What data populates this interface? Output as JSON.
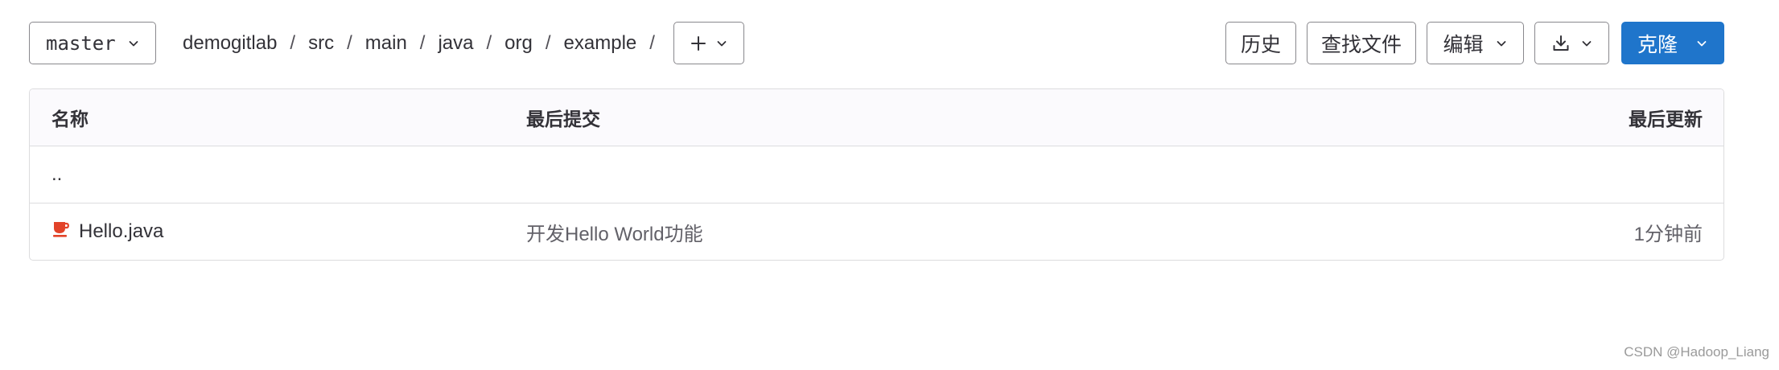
{
  "toolbar": {
    "branch": "master",
    "breadcrumb": [
      "demogitlab",
      "src",
      "main",
      "java",
      "org",
      "example"
    ],
    "separator": "/",
    "history_label": "历史",
    "find_file_label": "查找文件",
    "edit_label": "编辑",
    "clone_label": "克隆"
  },
  "file_table": {
    "columns": {
      "name": "名称",
      "last_commit": "最后提交",
      "last_update": "最后更新"
    },
    "parent_dir": "..",
    "rows": [
      {
        "icon": "java-file-icon",
        "name": "Hello.java",
        "last_commit": "开发Hello World功能",
        "last_update": "1分钟前"
      }
    ]
  },
  "watermark": "CSDN @Hadoop_Liang",
  "colors": {
    "primary": "#1f75cb",
    "java_icon": "#e24329",
    "border": "#dcdcde",
    "text": "#333238",
    "muted_text": "#626168"
  },
  "icons": {
    "branch_dropdown": "chevron-down-icon",
    "add": "plus-icon",
    "download": "download-icon",
    "clone_dropdown": "chevron-down-icon"
  }
}
